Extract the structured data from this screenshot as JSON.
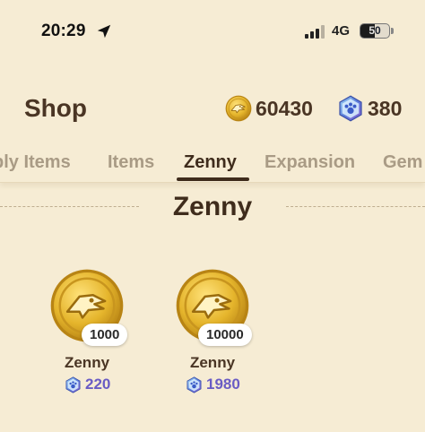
{
  "status_bar": {
    "time": "20:29",
    "network": "4G",
    "battery": "50",
    "battery_level": 0.5
  },
  "header": {
    "title": "Shop",
    "zenny_balance": "60430",
    "gem_balance": "380",
    "zenny_icon": "zenny-coin-icon",
    "gem_icon": "gem-icon"
  },
  "tabs": [
    {
      "label": "ply Items",
      "active": false
    },
    {
      "label": "Items",
      "active": false
    },
    {
      "label": "Zenny",
      "active": true
    },
    {
      "label": "Expansion",
      "active": false
    },
    {
      "label": "Gem",
      "active": false
    }
  ],
  "section": {
    "title": "Zenny"
  },
  "products": [
    {
      "quantity": "1000",
      "name": "Zenny",
      "price": "220"
    },
    {
      "quantity": "10000",
      "name": "Zenny",
      "price": "1980"
    }
  ],
  "colors": {
    "background": "#f6ecd4",
    "text_dark": "#4a3524",
    "tab_inactive": "#a99b85",
    "price": "#6a5cc4",
    "coin_gold": "#e5b52c",
    "gem_blue": "#5b7fdc"
  }
}
